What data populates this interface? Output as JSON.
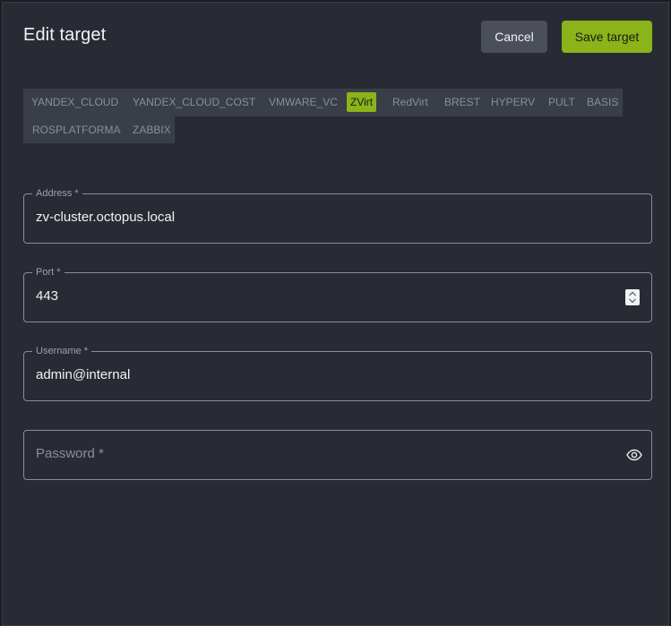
{
  "header": {
    "title": "Edit target",
    "cancel_label": "Cancel",
    "save_label": "Save target"
  },
  "tabs": [
    {
      "label": "YANDEX_CLOUD",
      "active": false
    },
    {
      "label": "YANDEX_CLOUD_COST",
      "active": false
    },
    {
      "label": "VMWARE_VC",
      "active": false
    },
    {
      "label": "ZVirt",
      "active": true
    },
    {
      "label": "RedVirt",
      "active": false
    },
    {
      "label": "BREST",
      "active": false
    },
    {
      "label": "HYPERV",
      "active": false
    },
    {
      "label": "PULT",
      "active": false
    },
    {
      "label": "BASIS",
      "active": false
    },
    {
      "label": "ROSPLATFORMA",
      "active": false
    },
    {
      "label": "ZABBIX",
      "active": false
    }
  ],
  "form": {
    "address": {
      "label": "Address *",
      "value": "zv-cluster.octopus.local"
    },
    "port": {
      "label": "Port *",
      "value": "443"
    },
    "username": {
      "label": "Username *",
      "value": "admin@internal"
    },
    "password": {
      "placeholder": "Password *",
      "value": ""
    }
  },
  "colors": {
    "accent": "#8bb31a",
    "panel": "#282b33",
    "tab_bar": "#3a3e47"
  },
  "icons": {
    "spinner": "number-spinner-icon",
    "password_toggle": "eye-icon"
  }
}
